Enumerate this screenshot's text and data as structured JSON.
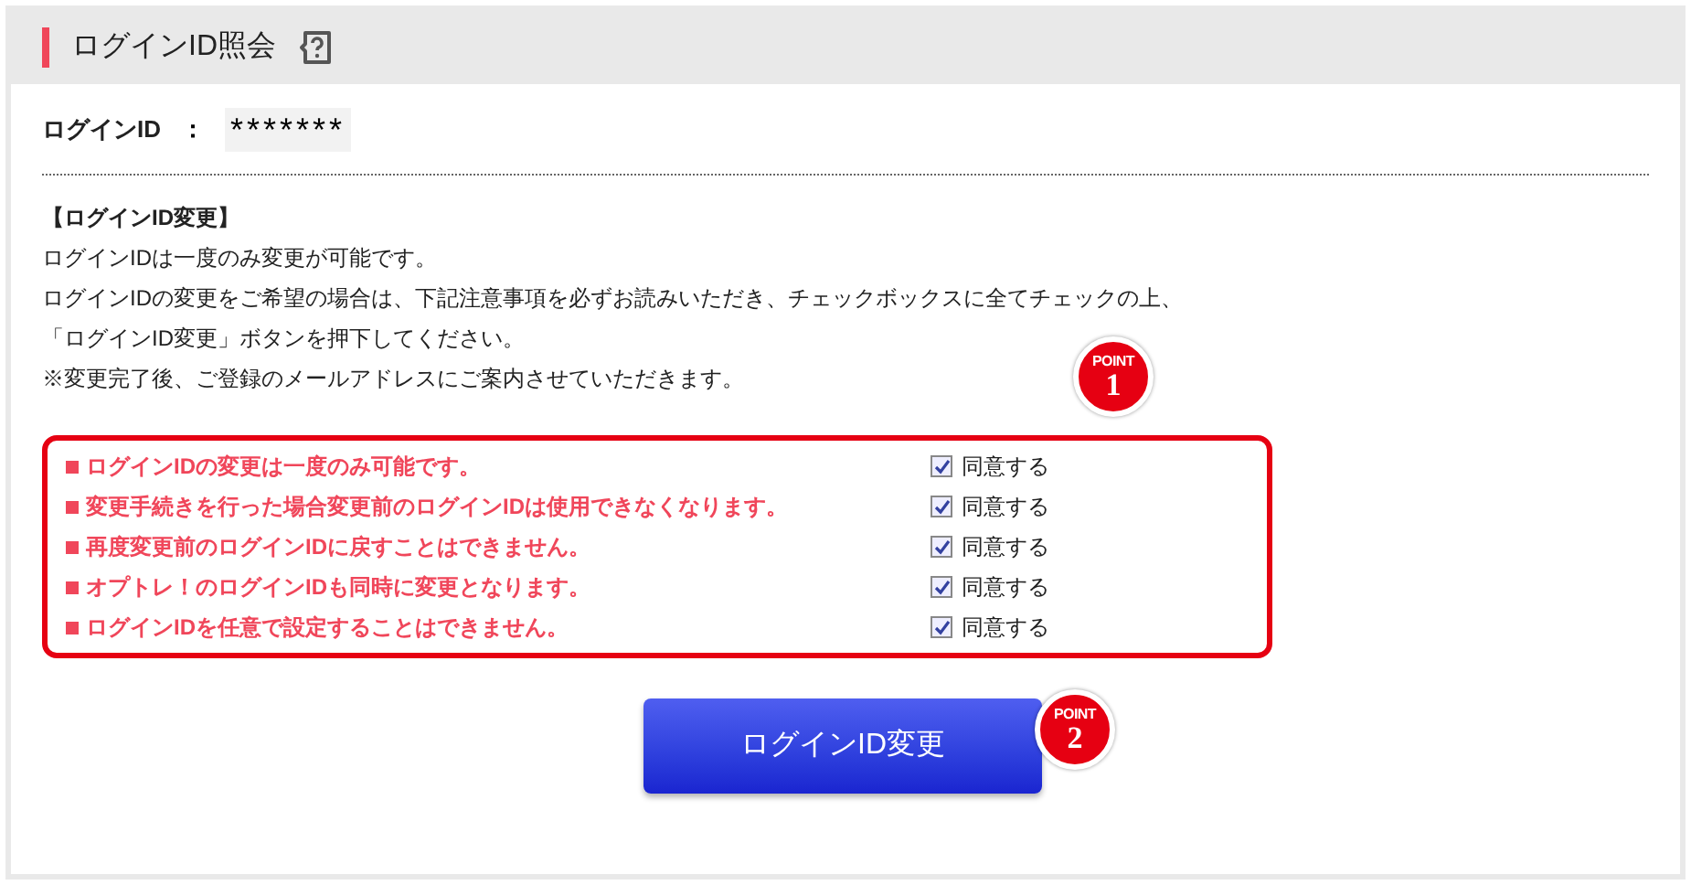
{
  "header": {
    "title": "ログインID照会"
  },
  "login_id": {
    "label": "ログインID",
    "separator": "：",
    "value": "*******"
  },
  "notice": {
    "heading": "【ログインID変更】",
    "lines": [
      "ログインIDは一度のみ変更が可能です。",
      "ログインIDの変更をご希望の場合は、下記注意事項を必ずお読みいただき、チェックボックスに全てチェックの上、",
      "「ログインID変更」ボタンを押下してください。",
      "※変更完了後、ご登録のメールアドレスにご案内させていただきます。"
    ]
  },
  "agreements": [
    {
      "text": "ログインIDの変更は一度のみ可能です。",
      "label": "同意する",
      "checked": true
    },
    {
      "text": "変更手続きを行った場合変更前のログインIDは使用できなくなります。",
      "label": "同意する",
      "checked": true
    },
    {
      "text": "再度変更前のログインIDに戻すことはできません。",
      "label": "同意する",
      "checked": true
    },
    {
      "text": "オプトレ！のログインIDも同時に変更となります。",
      "label": "同意する",
      "checked": true
    },
    {
      "text": "ログインIDを任意で設定することはできません。",
      "label": "同意する",
      "checked": true
    }
  ],
  "point_badges": [
    {
      "label": "POINT",
      "number": "1"
    },
    {
      "label": "POINT",
      "number": "2"
    }
  ],
  "submit_button": {
    "label": "ログインID変更"
  }
}
